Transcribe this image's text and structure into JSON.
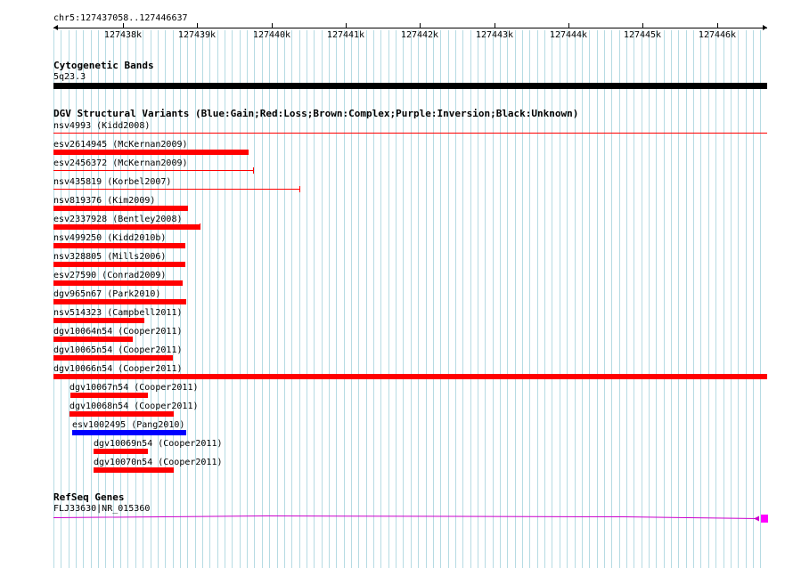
{
  "ruler": {
    "location": "chr5:127437058..127446637",
    "ticks": [
      "127438k",
      "127439k",
      "127440k",
      "127441k",
      "127442k",
      "127443k",
      "127444k",
      "127445k",
      "127446k"
    ]
  },
  "tracks": {
    "cytoband": {
      "title": "Cytogenetic Bands",
      "label": "5q23.3"
    },
    "dgv": {
      "title": "DGV Structural Variants (Blue:Gain;Red:Loss;Brown:Complex;Purple:Inversion;Black:Unknown)",
      "features": [
        {
          "label": "nsv4993 (Kidd2008)",
          "color": "#ff0000"
        },
        {
          "label": "esv2614945 (McKernan2009)",
          "color": "#ff0000"
        },
        {
          "label": "esv2456372 (McKernan2009)",
          "color": "#ff0000"
        },
        {
          "label": "nsv435819 (Korbel2007)",
          "color": "#ff0000"
        },
        {
          "label": "nsv819376 (Kim2009)",
          "color": "#ff0000"
        },
        {
          "label": "esv2337928 (Bentley2008)",
          "color": "#ff0000"
        },
        {
          "label": "nsv499250 (Kidd2010b)",
          "color": "#ff0000"
        },
        {
          "label": "nsv328805 (Mills2006)",
          "color": "#ff0000"
        },
        {
          "label": "esv27590 (Conrad2009)",
          "color": "#ff0000"
        },
        {
          "label": "dgv965n67 (Park2010)",
          "color": "#ff0000"
        },
        {
          "label": "nsv514323 (Campbell2011)",
          "color": "#ff0000"
        },
        {
          "label": "dgv10064n54 (Cooper2011)",
          "color": "#ff0000"
        },
        {
          "label": "dgv10065n54 (Cooper2011)",
          "color": "#ff0000"
        },
        {
          "label": "dgv10066n54 (Cooper2011)",
          "color": "#ff0000"
        },
        {
          "label": "dgv10067n54 (Cooper2011)",
          "color": "#ff0000"
        },
        {
          "label": "dgv10068n54 (Cooper2011)",
          "color": "#ff0000"
        },
        {
          "label": "esv1002495 (Pang2010)",
          "color": "#0000ff"
        },
        {
          "label": "dgv10069n54 (Cooper2011)",
          "color": "#ff0000"
        },
        {
          "label": "dgv10070n54 (Cooper2011)",
          "color": "#ff0000"
        }
      ]
    },
    "refseq": {
      "title": "RefSeq Genes",
      "label": "FLJ33630|NR_015360",
      "color": "#cc00cc",
      "end_color": "#ff00ff"
    }
  }
}
